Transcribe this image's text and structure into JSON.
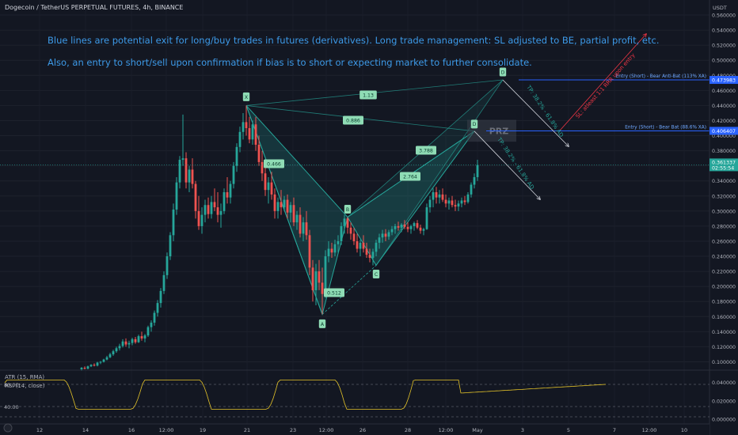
{
  "header": {
    "symbol": "Dogecoin / TetherUS PERPETUAL FUTURES, 4h, BINANCE",
    "currency": "USDT"
  },
  "notes": [
    "Blue lines are potential exit for long/buy trades in futures (derivatives). Long trade management: SL adjusted to BE, partial profit, etc.",
    "Also, an entry to short/sell upon confirmation if bias is to short or expecting market to further consolidate."
  ],
  "indicators": {
    "atr_label": "ATR (15, RMA)",
    "rsi_label": "RSI (14, close)"
  },
  "colors": {
    "up": "#26a69a",
    "down": "#ef5350",
    "note": "#3d9ae8",
    "pattern": "#26a69a",
    "entry": "#2962ff",
    "sl": "#f23645",
    "atr": "#e5c429"
  },
  "chart_data": {
    "type": "candlestick",
    "y_range": [
      0.09,
      0.58
    ],
    "price_ticks": [
      "0.560000",
      "0.540000",
      "0.520000",
      "0.500000",
      "0.480000",
      "0.460000",
      "0.440000",
      "0.420000",
      "0.400000",
      "0.380000",
      "0.360000",
      "0.340000",
      "0.320000",
      "0.300000",
      "0.280000",
      "0.260000",
      "0.240000",
      "0.220000",
      "0.200000",
      "0.180000",
      "0.160000",
      "0.140000",
      "0.120000",
      "0.100000"
    ],
    "time_ticks": [
      "12",
      "14",
      "16",
      "12:00",
      "19",
      "21",
      "23",
      "12:00",
      "26",
      "28",
      "12:00",
      "May",
      "3",
      "5",
      "7",
      "12:00",
      "10"
    ],
    "last_price": "0.361337",
    "last_countdown": "02:55:54",
    "levels": [
      {
        "price": 0.473983,
        "label": "Entry (Short) - Bear Anti-Bat (113% XA)",
        "value": "0.473983"
      },
      {
        "price": 0.406407,
        "label": "Entry (Short) - Bear Bat (88.6% XA)",
        "value": "0.406407"
      }
    ],
    "pattern_points": [
      {
        "name": "X",
        "bar": 52,
        "price": 0.44
      },
      {
        "name": "A",
        "bar": 76,
        "price": 0.163
      },
      {
        "name": "B",
        "bar": 84,
        "price": 0.292
      },
      {
        "name": "C",
        "bar": 93,
        "price": 0.228
      },
      {
        "name": "D",
        "bar": 124,
        "price": 0.406
      },
      {
        "name": "D",
        "bar": 133,
        "price": 0.474
      }
    ],
    "ratios": [
      "1.13",
      "0.886",
      "0.466",
      "3.788",
      "2.764",
      "0.512"
    ],
    "prz_label": "PRZ",
    "tp_labels": [
      "TP: 38.2% - 61.8% AD",
      "TP: 38.2% - 61.8% AD"
    ],
    "sl_label": "SL: atleast 1:1 RRR upon entry",
    "candles": [
      [
        0.09,
        0.093,
        0.088,
        0.092
      ],
      [
        0.092,
        0.094,
        0.09,
        0.091
      ],
      [
        0.091,
        0.095,
        0.09,
        0.094
      ],
      [
        0.094,
        0.097,
        0.093,
        0.096
      ],
      [
        0.096,
        0.098,
        0.094,
        0.095
      ],
      [
        0.095,
        0.1,
        0.094,
        0.099
      ],
      [
        0.099,
        0.101,
        0.097,
        0.1
      ],
      [
        0.1,
        0.104,
        0.099,
        0.103
      ],
      [
        0.103,
        0.108,
        0.102,
        0.106
      ],
      [
        0.106,
        0.112,
        0.105,
        0.11
      ],
      [
        0.11,
        0.116,
        0.108,
        0.114
      ],
      [
        0.114,
        0.12,
        0.112,
        0.118
      ],
      [
        0.118,
        0.124,
        0.115,
        0.121
      ],
      [
        0.121,
        0.13,
        0.119,
        0.127
      ],
      [
        0.127,
        0.131,
        0.12,
        0.123
      ],
      [
        0.123,
        0.128,
        0.118,
        0.125
      ],
      [
        0.125,
        0.132,
        0.122,
        0.13
      ],
      [
        0.13,
        0.133,
        0.124,
        0.126
      ],
      [
        0.126,
        0.136,
        0.125,
        0.134
      ],
      [
        0.134,
        0.14,
        0.128,
        0.131
      ],
      [
        0.131,
        0.137,
        0.126,
        0.135
      ],
      [
        0.135,
        0.148,
        0.133,
        0.146
      ],
      [
        0.146,
        0.155,
        0.14,
        0.152
      ],
      [
        0.152,
        0.168,
        0.148,
        0.165
      ],
      [
        0.165,
        0.182,
        0.16,
        0.178
      ],
      [
        0.178,
        0.198,
        0.172,
        0.194
      ],
      [
        0.194,
        0.22,
        0.19,
        0.215
      ],
      [
        0.215,
        0.245,
        0.21,
        0.24
      ],
      [
        0.24,
        0.272,
        0.235,
        0.268
      ],
      [
        0.268,
        0.31,
        0.26,
        0.302
      ],
      [
        0.302,
        0.345,
        0.295,
        0.338
      ],
      [
        0.338,
        0.373,
        0.33,
        0.368
      ],
      [
        0.368,
        0.428,
        0.36,
        0.37
      ],
      [
        0.37,
        0.378,
        0.33,
        0.338
      ],
      [
        0.338,
        0.36,
        0.325,
        0.355
      ],
      [
        0.355,
        0.37,
        0.33,
        0.336
      ],
      [
        0.336,
        0.34,
        0.29,
        0.3
      ],
      [
        0.3,
        0.32,
        0.275,
        0.28
      ],
      [
        0.28,
        0.305,
        0.27,
        0.295
      ],
      [
        0.295,
        0.315,
        0.285,
        0.308
      ],
      [
        0.308,
        0.318,
        0.29,
        0.296
      ],
      [
        0.296,
        0.32,
        0.29,
        0.312
      ],
      [
        0.312,
        0.33,
        0.3,
        0.305
      ],
      [
        0.305,
        0.325,
        0.285,
        0.295
      ],
      [
        0.295,
        0.31,
        0.278,
        0.3
      ],
      [
        0.3,
        0.33,
        0.296,
        0.325
      ],
      [
        0.325,
        0.345,
        0.31,
        0.318
      ],
      [
        0.318,
        0.34,
        0.31,
        0.336
      ],
      [
        0.336,
        0.365,
        0.33,
        0.36
      ],
      [
        0.36,
        0.39,
        0.352,
        0.385
      ],
      [
        0.385,
        0.412,
        0.378,
        0.405
      ],
      [
        0.405,
        0.43,
        0.395,
        0.418
      ],
      [
        0.418,
        0.44,
        0.4,
        0.41
      ],
      [
        0.41,
        0.425,
        0.39,
        0.395
      ],
      [
        0.395,
        0.42,
        0.388,
        0.415
      ],
      [
        0.415,
        0.425,
        0.38,
        0.388
      ],
      [
        0.388,
        0.4,
        0.36,
        0.365
      ],
      [
        0.365,
        0.38,
        0.34,
        0.35
      ],
      [
        0.35,
        0.36,
        0.32,
        0.328
      ],
      [
        0.328,
        0.345,
        0.31,
        0.338
      ],
      [
        0.338,
        0.352,
        0.315,
        0.322
      ],
      [
        0.322,
        0.33,
        0.29,
        0.3
      ],
      [
        0.3,
        0.318,
        0.29,
        0.312
      ],
      [
        0.312,
        0.328,
        0.295,
        0.305
      ],
      [
        0.305,
        0.32,
        0.3,
        0.315
      ],
      [
        0.315,
        0.322,
        0.29,
        0.298
      ],
      [
        0.298,
        0.312,
        0.285,
        0.308
      ],
      [
        0.308,
        0.318,
        0.28,
        0.285
      ],
      [
        0.285,
        0.3,
        0.275,
        0.295
      ],
      [
        0.295,
        0.305,
        0.265,
        0.27
      ],
      [
        0.27,
        0.292,
        0.26,
        0.285
      ],
      [
        0.285,
        0.3,
        0.262,
        0.268
      ],
      [
        0.268,
        0.275,
        0.215,
        0.225
      ],
      [
        0.225,
        0.235,
        0.18,
        0.195
      ],
      [
        0.195,
        0.23,
        0.175,
        0.22
      ],
      [
        0.22,
        0.235,
        0.195,
        0.205
      ],
      [
        0.205,
        0.225,
        0.163,
        0.19
      ],
      [
        0.19,
        0.248,
        0.185,
        0.24
      ],
      [
        0.24,
        0.26,
        0.232,
        0.25
      ],
      [
        0.25,
        0.258,
        0.238,
        0.245
      ],
      [
        0.245,
        0.262,
        0.24,
        0.256
      ],
      [
        0.256,
        0.268,
        0.245,
        0.26
      ],
      [
        0.26,
        0.285,
        0.255,
        0.28
      ],
      [
        0.28,
        0.295,
        0.27,
        0.29
      ],
      [
        0.29,
        0.292,
        0.27,
        0.278
      ],
      [
        0.278,
        0.285,
        0.262,
        0.27
      ],
      [
        0.27,
        0.278,
        0.255,
        0.26
      ],
      [
        0.26,
        0.27,
        0.245,
        0.25
      ],
      [
        0.25,
        0.262,
        0.24,
        0.258
      ],
      [
        0.258,
        0.268,
        0.245,
        0.25
      ],
      [
        0.25,
        0.258,
        0.238,
        0.242
      ],
      [
        0.242,
        0.25,
        0.232,
        0.238
      ],
      [
        0.238,
        0.25,
        0.228,
        0.246
      ],
      [
        0.246,
        0.262,
        0.24,
        0.258
      ],
      [
        0.258,
        0.27,
        0.25,
        0.265
      ],
      [
        0.265,
        0.275,
        0.258,
        0.27
      ],
      [
        0.27,
        0.276,
        0.26,
        0.266
      ],
      [
        0.266,
        0.275,
        0.262,
        0.272
      ],
      [
        0.272,
        0.28,
        0.268,
        0.276
      ],
      [
        0.276,
        0.283,
        0.27,
        0.28
      ],
      [
        0.28,
        0.286,
        0.274,
        0.278
      ],
      [
        0.278,
        0.284,
        0.272,
        0.282
      ],
      [
        0.282,
        0.288,
        0.276,
        0.279
      ],
      [
        0.279,
        0.285,
        0.272,
        0.276
      ],
      [
        0.276,
        0.282,
        0.27,
        0.28
      ],
      [
        0.28,
        0.286,
        0.274,
        0.284
      ],
      [
        0.284,
        0.288,
        0.276,
        0.278
      ],
      [
        0.278,
        0.282,
        0.27,
        0.274
      ],
      [
        0.274,
        0.278,
        0.268,
        0.276
      ],
      [
        0.276,
        0.31,
        0.275,
        0.305
      ],
      [
        0.305,
        0.32,
        0.298,
        0.315
      ],
      [
        0.315,
        0.33,
        0.305,
        0.325
      ],
      [
        0.325,
        0.332,
        0.31,
        0.318
      ],
      [
        0.318,
        0.328,
        0.31,
        0.322
      ],
      [
        0.322,
        0.33,
        0.312,
        0.315
      ],
      [
        0.315,
        0.322,
        0.305,
        0.31
      ],
      [
        0.31,
        0.318,
        0.302,
        0.314
      ],
      [
        0.314,
        0.32,
        0.305,
        0.308
      ],
      [
        0.308,
        0.315,
        0.3,
        0.306
      ],
      [
        0.306,
        0.314,
        0.3,
        0.31
      ],
      [
        0.31,
        0.318,
        0.305,
        0.314
      ],
      [
        0.314,
        0.32,
        0.308,
        0.312
      ],
      [
        0.312,
        0.325,
        0.31,
        0.322
      ],
      [
        0.322,
        0.338,
        0.318,
        0.335
      ],
      [
        0.335,
        0.35,
        0.33,
        0.345
      ],
      [
        0.345,
        0.368,
        0.34,
        0.361
      ]
    ],
    "atr_ticks": [
      "0.040000",
      "0.020000",
      "0.000000"
    ],
    "atr_level_labels": [
      "80.00",
      "40.00"
    ]
  }
}
